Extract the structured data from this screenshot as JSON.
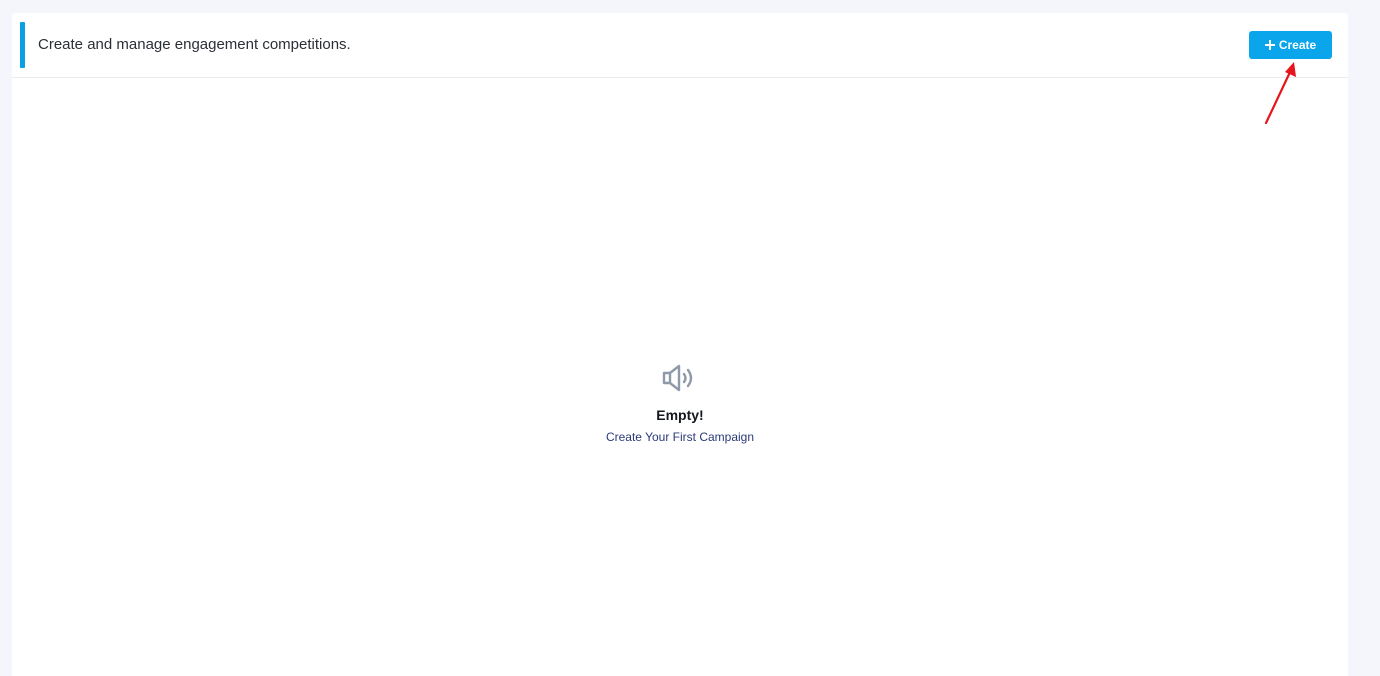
{
  "header": {
    "title": "Create and manage engagement competitions.",
    "create_label": "Create"
  },
  "empty_state": {
    "icon": "megaphone-icon",
    "title": "Empty!",
    "subtitle": "Create Your First Campaign"
  },
  "colors": {
    "accent": "#0a9fe3",
    "button": "#0aa5ea",
    "annotation_arrow": "#e8141c",
    "page_background": "#f4f6fb"
  }
}
